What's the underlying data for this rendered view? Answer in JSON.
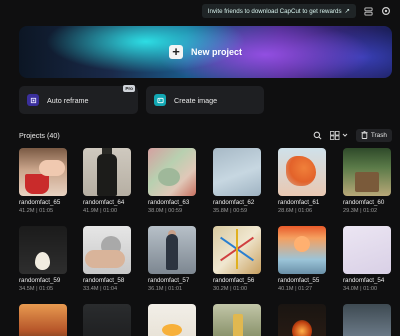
{
  "topbar": {
    "invite_text": "Invite friends to download CapCut to get rewards",
    "invite_arrow": "↗"
  },
  "hero": {
    "label": "New project",
    "plus": "+"
  },
  "tools": [
    {
      "label": "Auto reframe",
      "badge": "Pro",
      "icon": "reframe-icon",
      "color": "#3a2f9c"
    },
    {
      "label": "Create image",
      "badge": "",
      "icon": "image-generate-icon",
      "color": "#12a7b3"
    }
  ],
  "projects": {
    "title": "Projects  (40)",
    "trash_label": "Trash",
    "items": [
      {
        "name": "randomfact_65",
        "size": "41.2M",
        "duration": "01:05"
      },
      {
        "name": "randomfact_64",
        "size": "41.9M",
        "duration": "01:00"
      },
      {
        "name": "randomfact_63",
        "size": "38.0M",
        "duration": "00:59"
      },
      {
        "name": "randomfact_62",
        "size": "35.8M",
        "duration": "00:59"
      },
      {
        "name": "randomfact_61",
        "size": "28.6M",
        "duration": "01:06"
      },
      {
        "name": "randomfact_60",
        "size": "29.3M",
        "duration": "01:02"
      },
      {
        "name": "randomfact_59",
        "size": "34.5M",
        "duration": "01:05"
      },
      {
        "name": "randomfact_58",
        "size": "33.4M",
        "duration": "01:04"
      },
      {
        "name": "randomfact_57",
        "size": "36.1M",
        "duration": "01:01"
      },
      {
        "name": "randomfact_56",
        "size": "30.2M",
        "duration": "01:00"
      },
      {
        "name": "randomfact_55",
        "size": "40.1M",
        "duration": "01:27"
      },
      {
        "name": "randomfact_54",
        "size": "34.0M",
        "duration": "01:00"
      },
      {
        "name": "",
        "size": "",
        "duration": ""
      },
      {
        "name": "",
        "size": "",
        "duration": ""
      },
      {
        "name": "",
        "size": "",
        "duration": ""
      },
      {
        "name": "",
        "size": "",
        "duration": ""
      },
      {
        "name": "",
        "size": "",
        "duration": ""
      },
      {
        "name": "",
        "size": "",
        "duration": ""
      }
    ]
  }
}
